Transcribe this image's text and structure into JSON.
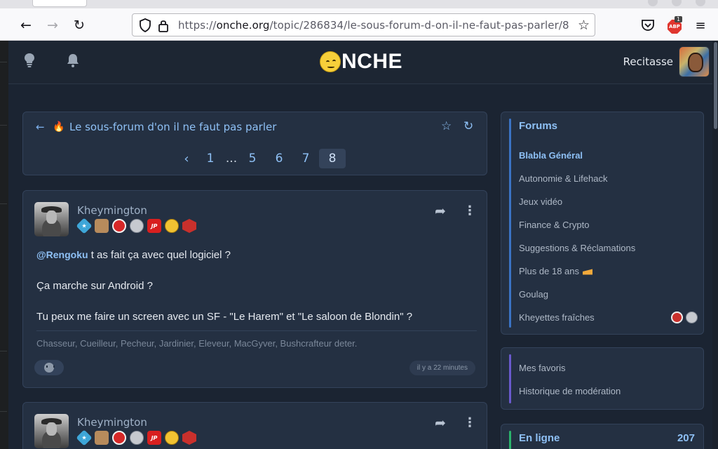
{
  "browser": {
    "url_prefix": "https://",
    "url_domain": "onche.org",
    "url_path": "/topic/286834/le-sous-forum-d-on-il-ne-faut-pas-parler/8",
    "adblock_count": "1",
    "adblock_label": "ABP"
  },
  "header": {
    "logo_text": "NCHE",
    "username": "Recitasse"
  },
  "topic": {
    "title": "Le sous-forum d'on il ne faut pas parler",
    "pages": {
      "prev": "‹",
      "first": "1",
      "ellipsis": "...",
      "p5": "5",
      "p6": "6",
      "p7": "7",
      "current": "8"
    }
  },
  "posts": [
    {
      "author": "Kheymington",
      "mention": "@Rengoku",
      "line1_rest": " t as fait ça avec quel logiciel ?",
      "line2": "Ça marche sur Android ?",
      "line3": "Tu peux me faire un screen avec un SF - \"Le Harem\" et \"Le saloon de Blondin\" ?",
      "signature": "Chasseur, Cueilleur, Pecheur, Jardinier, Eleveur, MacGyver, Bushcrafteur deter.",
      "time": "il y a 22 minutes",
      "badge_text_5": "JP"
    },
    {
      "author": "Kheymington",
      "badge_text_5": "JP"
    }
  ],
  "sidebar": {
    "forums_title": "Forums",
    "forums": [
      "Blabla Général",
      "Autonomie & Lifehack",
      "Jeux vidéo",
      "Finance & Crypto",
      "Suggestions & Réclamations",
      "Plus de 18 ans",
      "Goulag",
      "Kheyettes fraîches"
    ],
    "links": [
      "Mes favoris",
      "Historique de modération"
    ],
    "online_title": "En ligne",
    "online_count": "207"
  },
  "colors": {
    "page_bg": "#1b2432",
    "panel_bg": "#243042",
    "link_blue": "#8ec0f5",
    "accent_blue": "#3b73c4",
    "accent_purple": "#6a5acd",
    "accent_green": "#2bb36c"
  },
  "icons": [
    "back-arrow-icon",
    "forward-arrow-icon",
    "reload-icon",
    "shield-icon",
    "lock-icon",
    "bookmark-star-icon",
    "pocket-icon",
    "adblock-icon",
    "menu-icon",
    "lightbulb-icon",
    "bell-icon",
    "flame-icon",
    "star-icon",
    "refresh-icon",
    "share-icon",
    "more-options-icon",
    "reaction-icon",
    "cheese-icon"
  ]
}
